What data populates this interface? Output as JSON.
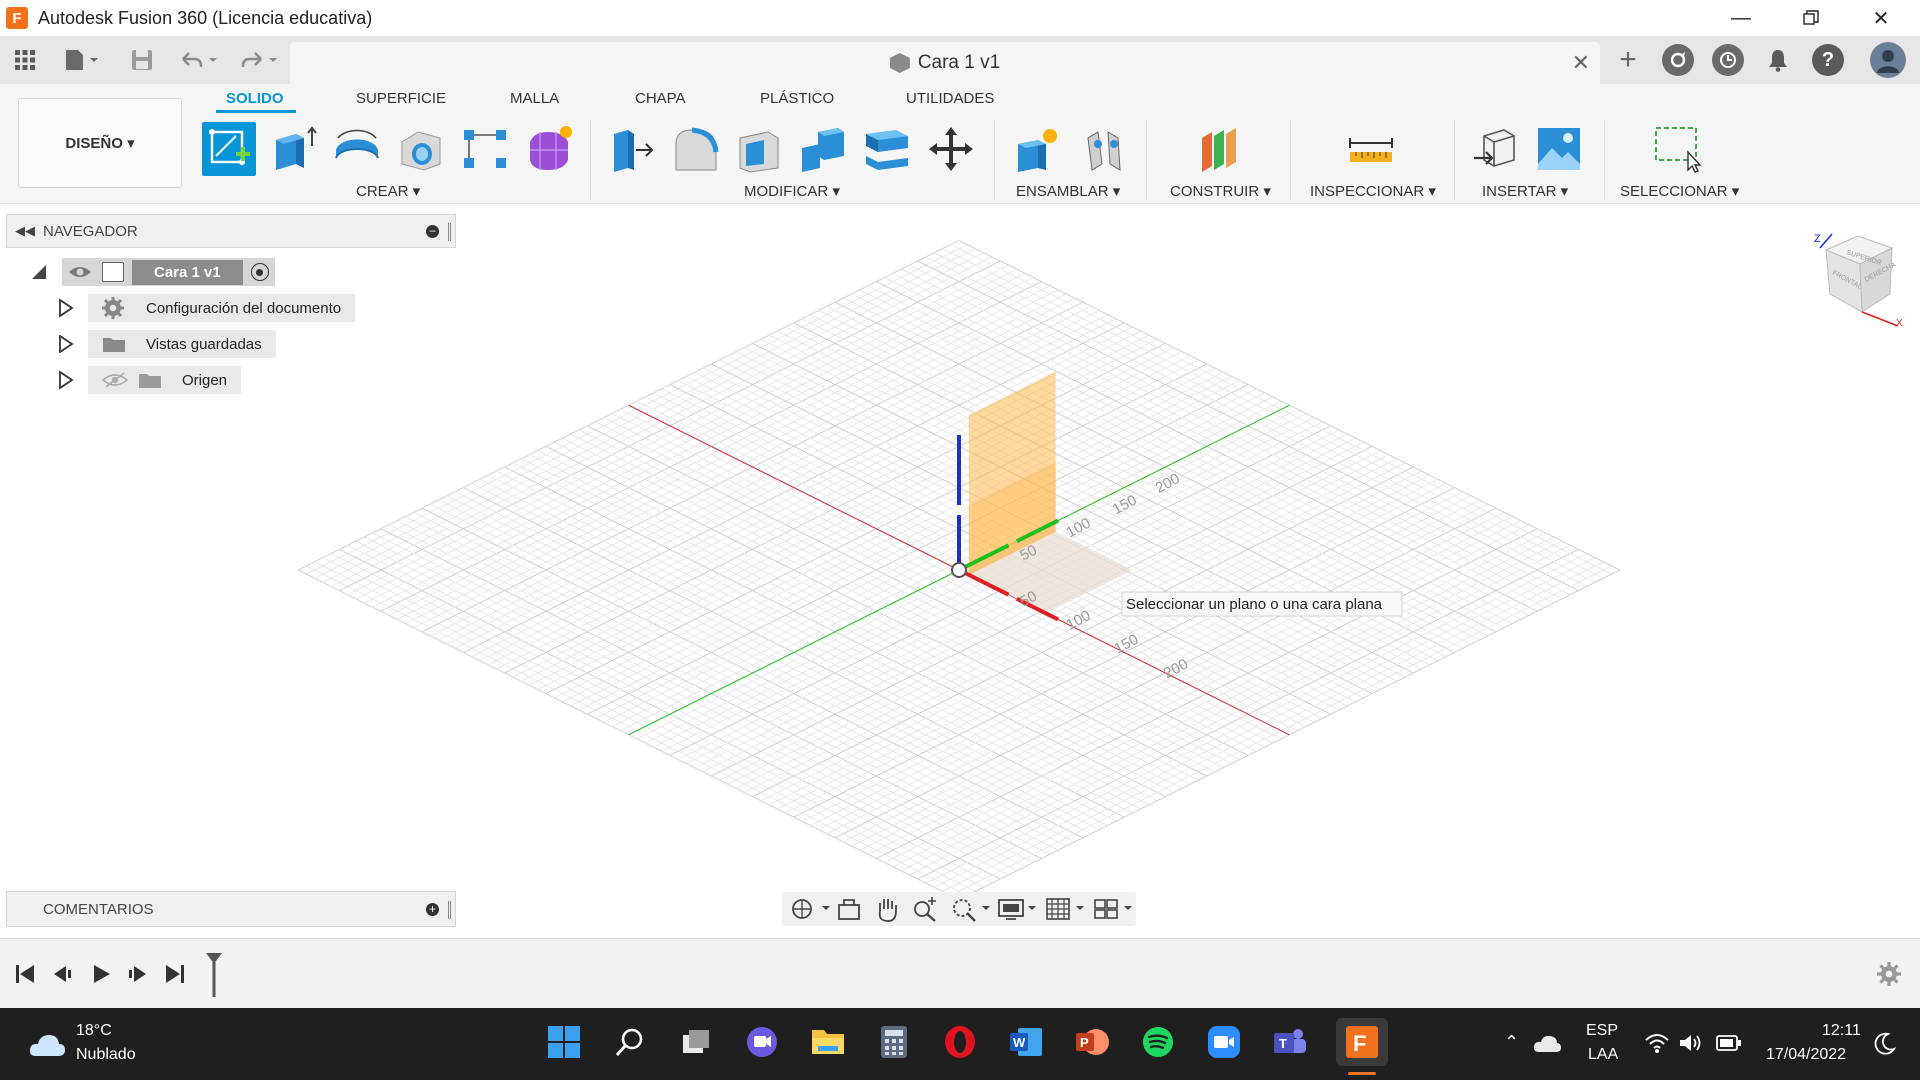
{
  "window": {
    "title": "Autodesk Fusion 360 (Licencia educativa)",
    "app_icon_letter": "F"
  },
  "document": {
    "tab_title": "Cara 1 v1"
  },
  "ribbon": {
    "workspace": "DISEÑO ▾",
    "tabs": [
      "SOLIDO",
      "SUPERFICIE",
      "MALLA",
      "CHAPA",
      "PLÁSTICO",
      "UTILIDADES"
    ],
    "active_tab": "SOLIDO",
    "groups": {
      "crear": "CREAR ▾",
      "modificar": "MODIFICAR ▾",
      "ensamblar": "ENSAMBLAR ▾",
      "construir": "CONSTRUIR ▾",
      "inspeccionar": "INSPECCIONAR ▾",
      "insertar": "INSERTAR ▾",
      "seleccionar": "SELECCIONAR ▾"
    }
  },
  "navigator": {
    "title": "NAVEGADOR",
    "root": "Cara 1 v1",
    "items": [
      "Configuración del documento",
      "Vistas guardadas",
      "Origen"
    ]
  },
  "comments": {
    "title": "COMENTARIOS"
  },
  "viewport": {
    "tooltip": "Seleccionar un plano o una cara plana",
    "axis_labels": [
      "200",
      "150",
      "100",
      "50",
      "50",
      "100",
      "150",
      "200"
    ],
    "colors": {
      "x_axis": "#e02020",
      "y_axis": "#1fbf1f",
      "z_axis": "#1a2fd6",
      "plane": "#ffb84d",
      "plane_dim": "#e8ddd2"
    }
  },
  "viewcube": {
    "labels": [
      "SUPERIOR",
      "FRONTAL",
      "DERECHA"
    ],
    "z": "Z",
    "x": "X"
  },
  "taskbar": {
    "weather_temp": "18°C",
    "weather_desc": "Nublado",
    "lang": "ESP",
    "lang2": "LAA",
    "time": "12:11",
    "date": "17/04/2022"
  }
}
